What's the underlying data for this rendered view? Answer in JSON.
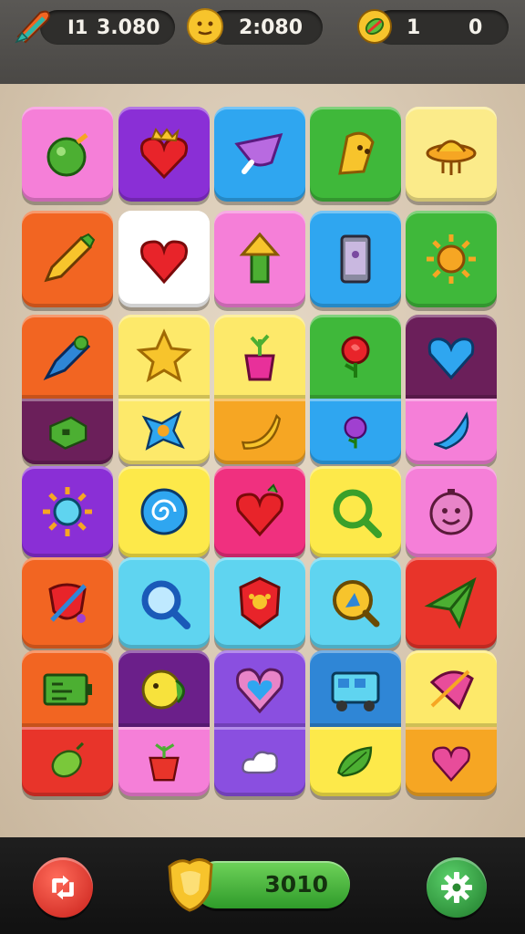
{
  "hud": {
    "lives": {
      "icon": "rocket-icon",
      "prefix": "I1",
      "value": "3.080"
    },
    "coins": {
      "icon": "smiley-coin-icon",
      "value": "2:080"
    },
    "gems": {
      "icon": "gem-icon",
      "value_left": "1",
      "value_right": "0"
    }
  },
  "board": {
    "columns": 5,
    "rows": 7,
    "tiles": [
      {
        "row": 0,
        "col": 0,
        "color": "#f57fd8",
        "icon": "green-bomb-icon"
      },
      {
        "row": 0,
        "col": 1,
        "color": "#8a2fd6",
        "icon": "crowned-heart-icon"
      },
      {
        "row": 0,
        "col": 2,
        "color": "#2fa6f0",
        "icon": "purple-fish-icon"
      },
      {
        "row": 0,
        "col": 3,
        "color": "#3fb83a",
        "icon": "yellow-ghost-icon"
      },
      {
        "row": 0,
        "col": 4,
        "color": "#fbeb8a",
        "icon": "ufo-icon"
      },
      {
        "row": 1,
        "col": 0,
        "color": "#f26522",
        "icon": "pencil-icon"
      },
      {
        "row": 1,
        "col": 1,
        "color": "#ffffff",
        "icon": "red-heart-icon"
      },
      {
        "row": 1,
        "col": 2,
        "color": "#f57fd8",
        "icon": "green-arrow-up-icon"
      },
      {
        "row": 1,
        "col": 3,
        "color": "#2fa6f0",
        "icon": "phone-icon"
      },
      {
        "row": 1,
        "col": 4,
        "color": "#3fb83a",
        "icon": "sun-icon"
      },
      {
        "row": 2,
        "col": 0,
        "color": "#f26522",
        "icon": "rocket-pen-icon"
      },
      {
        "row": 2,
        "col": 1,
        "color": "#fde96a",
        "icon": "star-icon"
      },
      {
        "row": 2,
        "col": 2,
        "color": "#fde96a",
        "icon": "potted-plant-icon"
      },
      {
        "row": 2,
        "col": 3,
        "color": "#3fb83a",
        "icon": "rose-icon"
      },
      {
        "row": 2,
        "col": 4,
        "color": "#6b1f5a",
        "icon": "blue-heart-icon"
      },
      {
        "row": 3,
        "col": 0,
        "color": "#6b1f5a",
        "icon": "green-box-icon"
      },
      {
        "row": 3,
        "col": 1,
        "color": "#fde96a",
        "icon": "blue-star-icon"
      },
      {
        "row": 3,
        "col": 2,
        "color": "#f6a623",
        "icon": "banana-icon"
      },
      {
        "row": 3,
        "col": 3,
        "color": "#2fa6f0",
        "icon": "purple-rose-icon"
      },
      {
        "row": 3,
        "col": 4,
        "color": "#f57fd8",
        "icon": "blue-leaf-icon"
      },
      {
        "row": 4,
        "col": 0,
        "color": "#8a2fd6",
        "icon": "blue-sun-icon"
      },
      {
        "row": 4,
        "col": 1,
        "color": "#fde94a",
        "icon": "spiral-icon"
      },
      {
        "row": 4,
        "col": 2,
        "color": "#f0307f",
        "icon": "heart-strawberry-icon"
      },
      {
        "row": 4,
        "col": 3,
        "color": "#fde94a",
        "icon": "magnifier-icon"
      },
      {
        "row": 4,
        "col": 4,
        "color": "#f57fd8",
        "icon": "face-ball-icon"
      },
      {
        "row": 5,
        "col": 0,
        "color": "#f26522",
        "icon": "shield-sword-icon"
      },
      {
        "row": 5,
        "col": 1,
        "color": "#5fd4f0",
        "icon": "blue-magnifier-icon"
      },
      {
        "row": 5,
        "col": 2,
        "color": "#5fd4f0",
        "icon": "badge-icon"
      },
      {
        "row": 5,
        "col": 3,
        "color": "#5fd4f0",
        "icon": "compass-icon"
      },
      {
        "row": 5,
        "col": 4,
        "color": "#e8342a",
        "icon": "paper-plane-icon"
      },
      {
        "row": 6,
        "col": 0,
        "color": "#f26522",
        "icon": "battery-icon"
      },
      {
        "row": 6,
        "col": 1,
        "color": "#6b1f8a",
        "icon": "chick-icon"
      },
      {
        "row": 6,
        "col": 2,
        "color": "#8a4fe0",
        "icon": "heart-frame-icon"
      },
      {
        "row": 6,
        "col": 3,
        "color": "#2f86d6",
        "icon": "bus-icon"
      },
      {
        "row": 6,
        "col": 4,
        "color": "#fde96a",
        "icon": "pink-cone-icon"
      },
      {
        "row": 7,
        "col": 0,
        "color": "#e8342a",
        "icon": "green-fruit-icon"
      },
      {
        "row": 7,
        "col": 1,
        "color": "#f57fd8",
        "icon": "red-pot-icon"
      },
      {
        "row": 7,
        "col": 2,
        "color": "#8a4fe0",
        "icon": "white-cloud-icon"
      },
      {
        "row": 7,
        "col": 3,
        "color": "#fde94a",
        "icon": "green-leaf-icon"
      },
      {
        "row": 7,
        "col": 4,
        "color": "#f6a623",
        "icon": "pink-heart-icon"
      }
    ]
  },
  "bottom": {
    "refresh_icon": "refresh-icon",
    "shield_icon": "gold-shield-icon",
    "score": "3010",
    "settings_icon": "gear-icon"
  }
}
